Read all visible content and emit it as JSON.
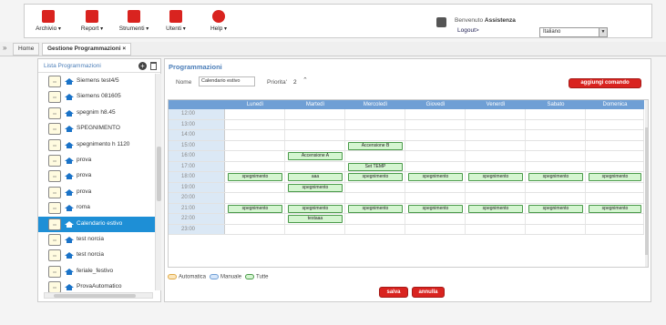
{
  "menu": [
    {
      "label": "Archivio",
      "icon": "archive-icon",
      "color": "#d9231f"
    },
    {
      "label": "Report",
      "icon": "report-icon",
      "color": "#d9231f"
    },
    {
      "label": "Strumenti",
      "icon": "tools-icon",
      "color": "#d9231f"
    },
    {
      "label": "Utenti",
      "icon": "users-icon",
      "color": "#d9231f"
    },
    {
      "label": "Help",
      "icon": "help-icon",
      "color": "#d9231f"
    }
  ],
  "user": {
    "welcome": "Benvenuto",
    "name": "Assistenza",
    "logout": "Logout>",
    "language": "Italiano"
  },
  "tabs": [
    {
      "label": "Home"
    },
    {
      "label": "Gestione Programmazioni ×"
    }
  ],
  "sidebar": {
    "title": "Lista Programmazioni",
    "items": [
      {
        "label": "Siemens test4/5"
      },
      {
        "label": "Siemens 081605"
      },
      {
        "label": "spegnim h8.45"
      },
      {
        "label": "SPEGNIMENTO"
      },
      {
        "label": "spegnimento h 1120"
      },
      {
        "label": "prova"
      },
      {
        "label": "prova"
      },
      {
        "label": "prova"
      },
      {
        "label": "roma"
      },
      {
        "label": "Calendario estivo",
        "selected": true
      },
      {
        "label": "test norcia"
      },
      {
        "label": "test norcia"
      },
      {
        "label": "feriale_festivo"
      },
      {
        "label": "ProvaAutomatico"
      }
    ],
    "hscroll_label": "III"
  },
  "main": {
    "title": "Programmazioni",
    "nome_label": "Nome",
    "nome_value": "Calendario estivo",
    "priorita_label": "Priorita'",
    "priorita_value": "2",
    "add_button": "aggiungi comando",
    "days": [
      "Lunedì",
      "Martedì",
      "Mercoledì",
      "Giovedì",
      "Venerdì",
      "Sabato",
      "Domenica"
    ],
    "hours": [
      "12:00",
      "13:00",
      "14:00",
      "15:00",
      "16:00",
      "17:00",
      "18:00",
      "19:00",
      "20:00",
      "21:00",
      "22:00",
      "23:00"
    ],
    "events": [
      {
        "hour": 3,
        "day": 2,
        "label": "Accensione B"
      },
      {
        "hour": 4,
        "day": 1,
        "label": "Accensione A"
      },
      {
        "hour": 5,
        "day": 2,
        "label": "Set TEMP"
      },
      {
        "hour": 6,
        "day": 0,
        "label": "spegnimento"
      },
      {
        "hour": 6,
        "day": 1,
        "label": "aaa"
      },
      {
        "hour": 6,
        "day": 2,
        "label": "spegnimento"
      },
      {
        "hour": 6,
        "day": 3,
        "label": "spegnimento"
      },
      {
        "hour": 6,
        "day": 4,
        "label": "spegnimento"
      },
      {
        "hour": 6,
        "day": 5,
        "label": "spegnimento"
      },
      {
        "hour": 6,
        "day": 6,
        "label": "spegnimento"
      },
      {
        "hour": 7,
        "day": 1,
        "label": "spegnimento"
      },
      {
        "hour": 9,
        "day": 0,
        "label": "spegnimento"
      },
      {
        "hour": 9,
        "day": 1,
        "label": "spegnimento"
      },
      {
        "hour": 9,
        "day": 2,
        "label": "spegnimento"
      },
      {
        "hour": 9,
        "day": 3,
        "label": "spegnimento"
      },
      {
        "hour": 9,
        "day": 4,
        "label": "spegnimento"
      },
      {
        "hour": 9,
        "day": 5,
        "label": "spegnimento"
      },
      {
        "hour": 9,
        "day": 6,
        "label": "spegnimento"
      },
      {
        "hour": 10,
        "day": 1,
        "label": "testaaa"
      }
    ],
    "legend": {
      "automatica": "Automatica",
      "manuale": "Manuale",
      "tutte": "Tutte"
    },
    "save_button": "salva",
    "cancel_button": "annulla"
  }
}
